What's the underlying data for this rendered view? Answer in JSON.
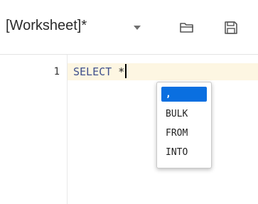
{
  "header": {
    "title": "[Worksheet]*",
    "dropdown_icon": "chevron-down-icon",
    "open_icon": "folder-open-icon",
    "save_icon": "save-icon"
  },
  "editor": {
    "line_number": "1",
    "code": {
      "keyword": "SELECT",
      "operator": "*"
    }
  },
  "autocomplete": {
    "items": [
      ",",
      "BULK",
      "FROM",
      "INTO"
    ],
    "selected_index": 0
  },
  "colors": {
    "accent": "#0a6fe0",
    "active_line": "#fdf6e2",
    "keyword": "#3f4f8c"
  }
}
